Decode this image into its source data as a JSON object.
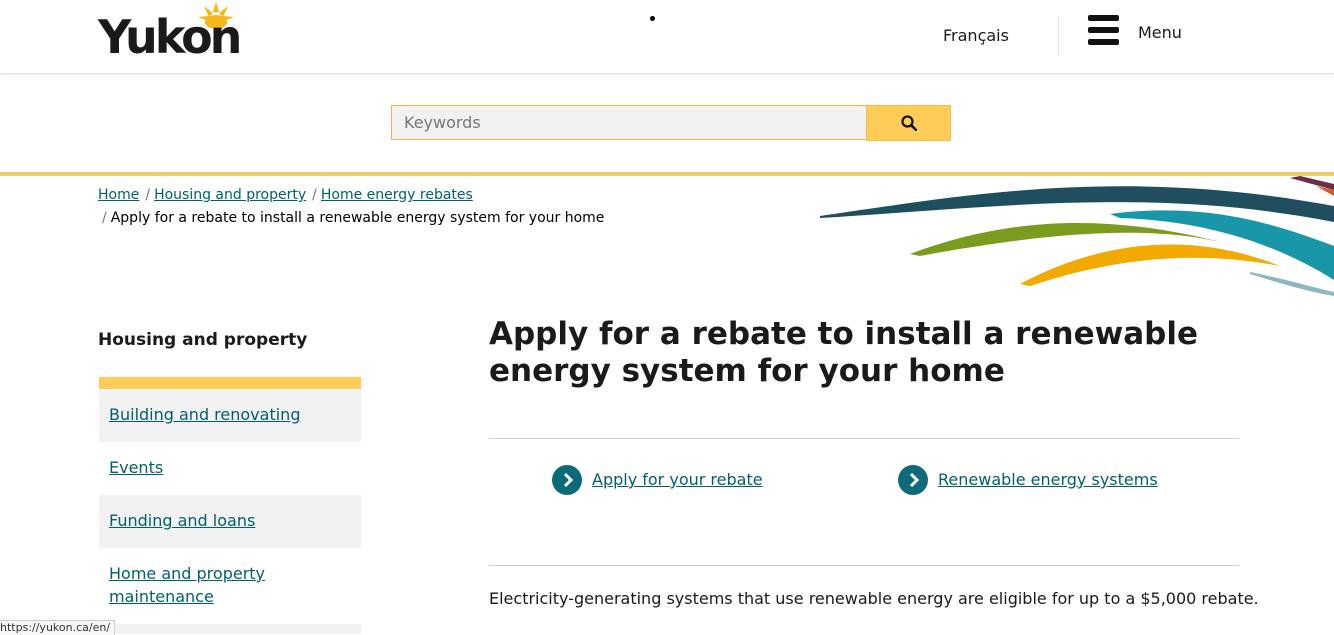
{
  "header": {
    "logo_text": "Yukon",
    "language_link": "Français",
    "menu_label": "Menu"
  },
  "search": {
    "placeholder": "Keywords"
  },
  "breadcrumb": {
    "items": [
      "Home",
      "Housing and property",
      "Home energy rebates"
    ],
    "separator": "/",
    "current": "Apply for a rebate to install a renewable energy system for your home"
  },
  "sidebar": {
    "title": "Housing and property",
    "items": [
      {
        "label": "Building and renovating"
      },
      {
        "label": "Events"
      },
      {
        "label": "Funding and loans"
      },
      {
        "label": "Home and property maintenance"
      }
    ]
  },
  "main": {
    "title": "Apply for a rebate to install a renewable energy system for your home",
    "links": [
      {
        "label": "Apply for your rebate"
      },
      {
        "label": "Renewable energy systems"
      }
    ],
    "intro": "Electricity-generating systems that use renewable energy are eligible for up to a $5,000 rebate."
  },
  "status_bar": {
    "url": "https://yukon.ca/en/"
  },
  "colors": {
    "accent_gold": "#ffcd57",
    "link_teal": "#00616d",
    "cta_circle": "#0d6b79"
  }
}
